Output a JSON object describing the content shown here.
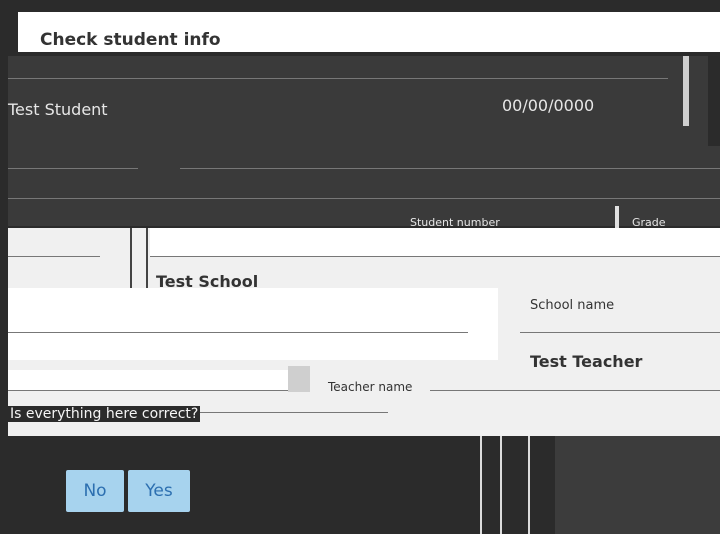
{
  "dialog": {
    "title": "Check student info",
    "question": "Is everything here correct?"
  },
  "student": {
    "name": "Test Student",
    "dob": "00/00/0000",
    "student_number_label": "Student number",
    "grade_label": "Grade"
  },
  "school": {
    "value": "Test School",
    "label": "School name"
  },
  "teacher": {
    "value": "Test Teacher",
    "label": "Teacher name"
  },
  "buttons": {
    "no": "No",
    "yes": "Yes"
  },
  "colors": {
    "background": "#2b2b2b",
    "button_bg": "#a7d3ee",
    "button_text": "#2c6fb0"
  }
}
